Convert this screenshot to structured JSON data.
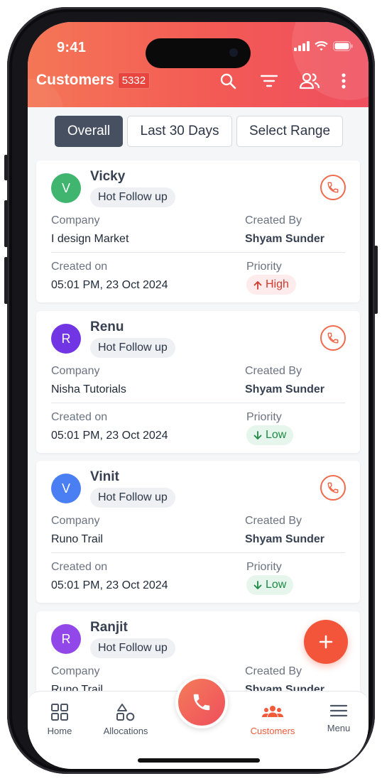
{
  "status": {
    "time": "9:41"
  },
  "header": {
    "title": "Customers",
    "count": "5332"
  },
  "tabs": [
    {
      "label": "Overall"
    },
    {
      "label": "Last 30 Days"
    },
    {
      "label": "Select Range"
    }
  ],
  "labels": {
    "company": "Company",
    "created_by": "Created By",
    "created_on": "Created on",
    "priority": "Priority"
  },
  "cards": [
    {
      "initial": "V",
      "name": "Vicky",
      "tag": "Hot Follow up",
      "company": "I design Market",
      "created_by": "Shyam Sunder",
      "created_on": "05:01 PM, 23 Oct 2024",
      "priority": "High",
      "avatar_color": "#3fb56f"
    },
    {
      "initial": "R",
      "name": "Renu",
      "tag": "Hot Follow up",
      "company": "Nisha Tutorials",
      "created_by": "Shyam Sunder",
      "created_on": "05:01 PM, 23 Oct 2024",
      "priority": "Low",
      "avatar_color": "#7235e3"
    },
    {
      "initial": "V",
      "name": "Vinit",
      "tag": "Hot Follow up",
      "company": "Runo Trail",
      "created_by": "Shyam Sunder",
      "created_on": "05:01 PM, 23 Oct 2024",
      "priority": "Low",
      "avatar_color": "#4a7ff3"
    },
    {
      "initial": "R",
      "name": "Ranjit",
      "tag": "Hot Follow up",
      "company": "Runo Trail",
      "created_by": "Shyam Sunder",
      "avatar_color": "#9248e8"
    }
  ],
  "nav": [
    {
      "label": "Home",
      "icon": "grid-icon"
    },
    {
      "label": "Allocations",
      "icon": "shapes-icon"
    },
    {
      "label": "Customers",
      "icon": "users-icon",
      "active": true
    },
    {
      "label": "Menu",
      "icon": "menu-icon"
    }
  ],
  "colors": {
    "accent": "#f3553a",
    "header_start": "#f47656",
    "header_end": "#ef4f5e",
    "tab_active": "#475061"
  }
}
